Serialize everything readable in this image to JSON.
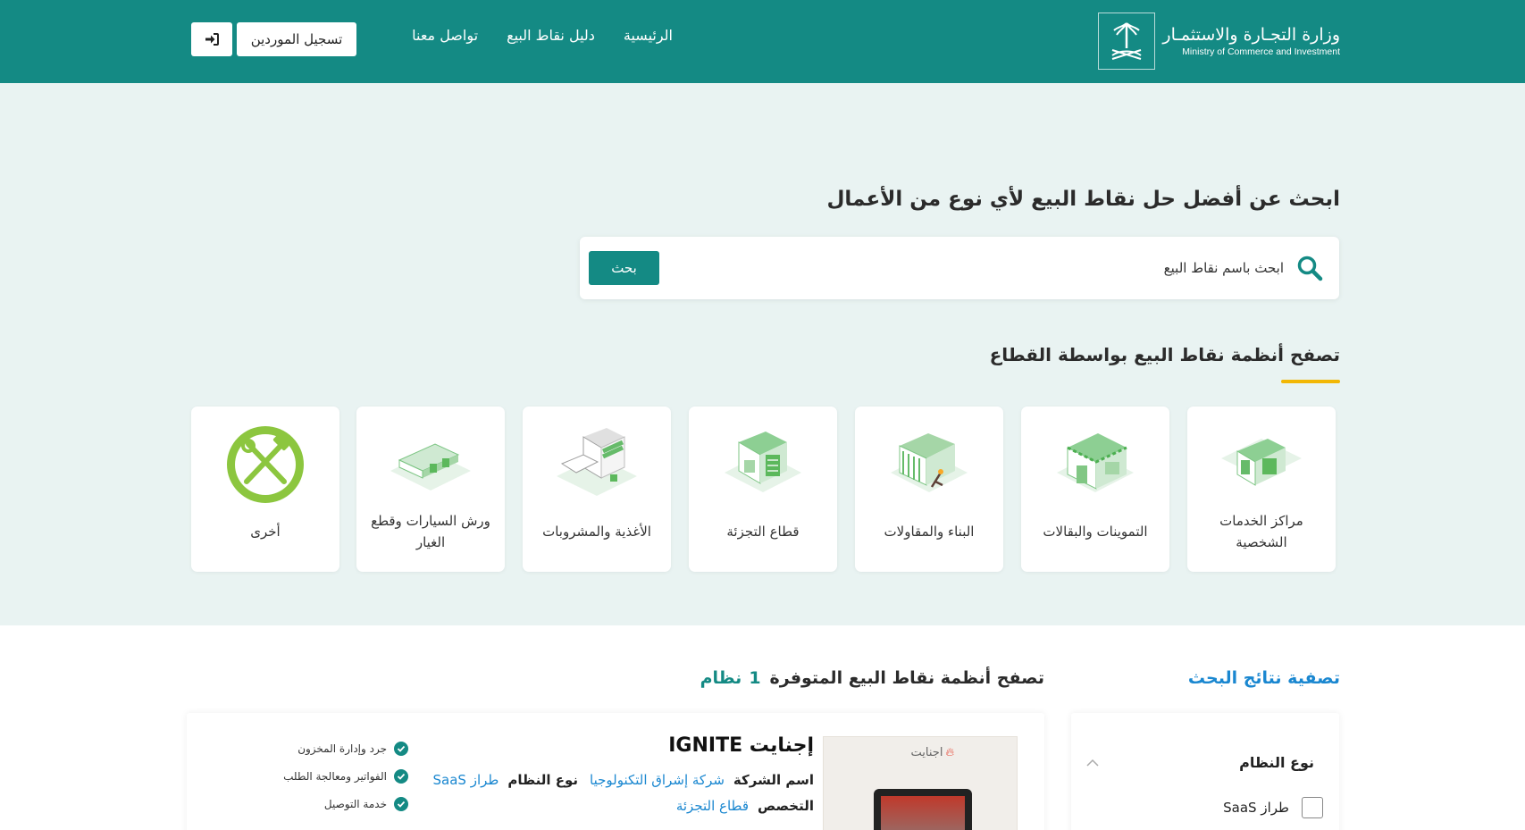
{
  "header": {
    "logo": {
      "name_ar": "وزارة التجـارة والاستثمـار",
      "name_en": "Ministry of Commerce and Investment"
    },
    "nav": [
      {
        "label": "الرئيسية"
      },
      {
        "label": "دليل نقاط البيع"
      },
      {
        "label": "تواصل معنا"
      }
    ],
    "register_button": "تسجيل الموردين",
    "login_icon": "sign-in-icon",
    "brand_color": "#148a84"
  },
  "hero": {
    "title": "ابحث عن أفضل حل نقاط البيع لأي نوع من الأعمال",
    "search": {
      "placeholder": "ابحث باسم نقاط البيع",
      "button": "بحث"
    },
    "browse_title": "تصفح أنظمة نقاط البيع بواسطة القطاع",
    "accent_color": "#f2b705",
    "sectors": [
      {
        "label": "مراكز الخدمات الشخصية",
        "icon": "storefront-icon"
      },
      {
        "label": "التموينات والبقالات",
        "icon": "grocery-store-icon"
      },
      {
        "label": "البناء والمقاولات",
        "icon": "construction-store-icon"
      },
      {
        "label": "قطاع التجزئة",
        "icon": "retail-store-icon"
      },
      {
        "label": "الأغذية والمشروبات",
        "icon": "cafe-icon"
      },
      {
        "label": "ورش السيارات وقطع الغيار",
        "icon": "garage-icon"
      },
      {
        "label": "أخرى",
        "icon": "tools-icon"
      }
    ]
  },
  "results": {
    "filter_title": "تصفية نتائج البحث",
    "title": "تصفح أنظمة نقاط البيع المتوفرة",
    "count": "1",
    "count_unit": "نظام",
    "filter": {
      "heading": "نوع النظام",
      "options": [
        {
          "label": "طراز SaaS",
          "checked": false
        }
      ]
    },
    "product": {
      "name": "إجنايت IGNITE",
      "image_logo_text": "اجنايت",
      "company_label": "اسم الشركة",
      "company_value": "شركة إشراق التكنولوجيا",
      "specialty_label": "التخصص",
      "specialty_value": "قطاع التجزئة",
      "system_type_label": "نوع النظام",
      "system_type_value": "طراز SaaS",
      "features": [
        "جرد وإدارة المخزون",
        "الفواتير ومعالجة الطلب",
        "خدمة التوصيل"
      ]
    }
  }
}
